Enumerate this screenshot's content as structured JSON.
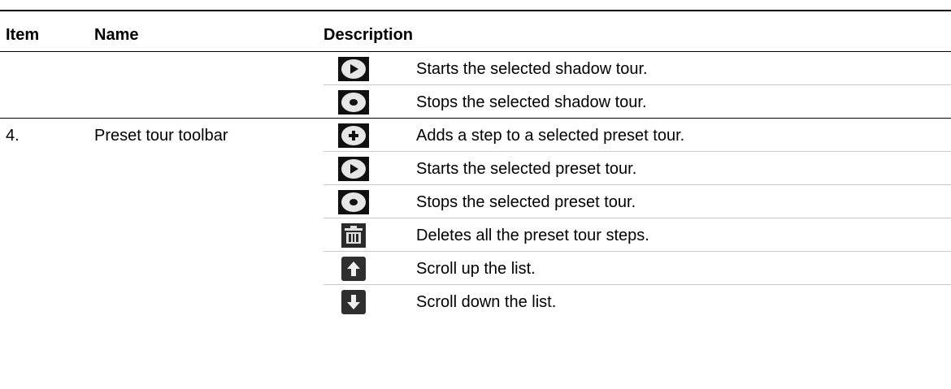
{
  "table": {
    "headers": {
      "item": "Item",
      "name": "Name",
      "description": "Description"
    },
    "rows": [
      {
        "item": "",
        "name": "",
        "icon": "play-icon",
        "description": "Starts the selected shadow tour."
      },
      {
        "item": "",
        "name": "",
        "icon": "stop-icon",
        "description": "Stops the selected shadow tour."
      },
      {
        "item": "4.",
        "name": "Preset tour toolbar",
        "icon": "add-step-icon",
        "description": "Adds a step to a selected preset tour."
      },
      {
        "item": "",
        "name": "",
        "icon": "play-icon",
        "description": "Starts the selected preset tour."
      },
      {
        "item": "",
        "name": "",
        "icon": "stop-icon",
        "description": "Stops the selected preset tour."
      },
      {
        "item": "",
        "name": "",
        "icon": "trash-icon",
        "description": "Deletes all the preset tour steps."
      },
      {
        "item": "",
        "name": "",
        "icon": "arrow-up-icon",
        "description": "Scroll up the list."
      },
      {
        "item": "",
        "name": "",
        "icon": "arrow-down-icon",
        "description": "Scroll down the list."
      }
    ]
  }
}
